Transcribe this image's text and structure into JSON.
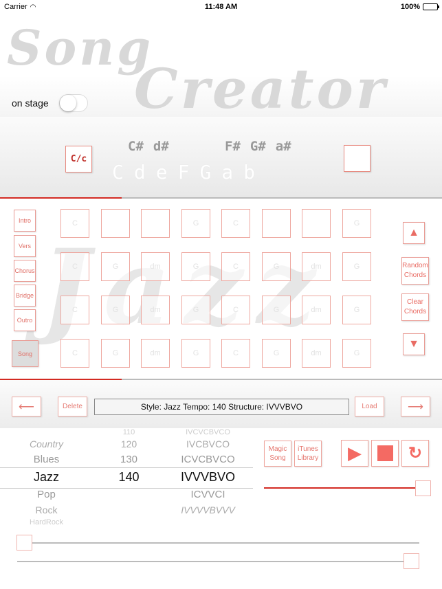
{
  "status_bar": {
    "carrier": "Carrier",
    "time": "11:48 AM",
    "battery": "100%"
  },
  "header": {
    "logo_line1": "Song",
    "logo_line2": "Creator",
    "on_stage_label": "on stage",
    "on_stage_enabled": false
  },
  "key_selector": {
    "key_button_label": "C/c",
    "sharps": [
      "C#",
      "d#",
      "F#",
      "G#",
      "a#"
    ],
    "naturals": [
      "C",
      "d",
      "e",
      "F",
      "G",
      "a",
      "b"
    ],
    "progress_percent": 27.5
  },
  "sections": [
    {
      "label": "Intro",
      "active": false
    },
    {
      "label": "Vers",
      "active": false
    },
    {
      "label": "Chorus",
      "active": false
    },
    {
      "label": "Bridge",
      "active": false
    },
    {
      "label": "Outro",
      "active": false
    },
    {
      "label": "Song",
      "active": true
    }
  ],
  "background_style_text": "Jazz",
  "chord_grid": [
    [
      "C",
      "",
      "",
      "G",
      "C",
      "",
      "",
      "G"
    ],
    [
      "C",
      "G",
      "dm",
      "G",
      "C",
      "G",
      "dm",
      "G"
    ],
    [
      "C",
      "G",
      "dm",
      "G",
      "C",
      "G",
      "dm",
      "G"
    ],
    [
      "C",
      "G",
      "dm",
      "G",
      "C",
      "G",
      "dm",
      "G"
    ]
  ],
  "side_buttons": {
    "up_icon": "▲",
    "random_chords": "Random Chords",
    "clear_chords": "Clear Chords",
    "down_icon": "▼"
  },
  "playback_progress_percent": 27.5,
  "transport": {
    "prev_icon": "⟵",
    "delete": "Delete",
    "info": "Style: Jazz   Tempo: 140   Structure: IVVVBVO",
    "load": "Load",
    "next_icon": "⟶"
  },
  "picker": {
    "styles": [
      "",
      "Country",
      "Blues",
      "Jazz",
      "Pop",
      "Rock",
      "HardRock"
    ],
    "tempos": [
      "110",
      "120",
      "130",
      "140",
      "",
      "",
      ""
    ],
    "structures": [
      "IVCVCBVCO",
      "IVCBVCO",
      "ICVCBVCO",
      "IVVVBVO",
      "ICVVCI",
      "IVVVVBVVV",
      ""
    ],
    "selected_index": 3
  },
  "controls": {
    "magic_song": "Magic Song",
    "itunes_library": "iTunes Library",
    "play_icon": "▶",
    "stop_icon": "■",
    "repeat_icon": "↻",
    "volume_percent": 100
  },
  "sliders": {
    "slider1_percent": 0,
    "slider2_percent": 100
  },
  "colors": {
    "accent": "#e0453c",
    "progress": "#d32a22",
    "button_border": "#eea39b"
  }
}
